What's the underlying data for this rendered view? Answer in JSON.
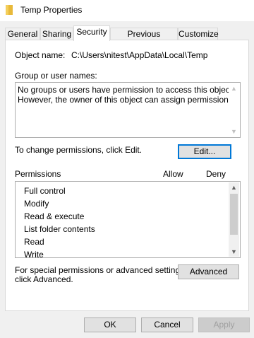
{
  "window": {
    "title": "Temp Properties"
  },
  "tabs": [
    {
      "label": "General"
    },
    {
      "label": "Sharing"
    },
    {
      "label": "Security"
    },
    {
      "label": "Previous Versions"
    },
    {
      "label": "Customize"
    }
  ],
  "object": {
    "label": "Object name:",
    "value": "C:\\Users\\nitest\\AppData\\Local\\Temp"
  },
  "groups": {
    "label": "Group or user names:",
    "message_line1": "No groups or users have permission to access this object.",
    "message_line2": "However, the owner of this object can assign permissions."
  },
  "change": {
    "text": "To change permissions, click Edit.",
    "edit_label": "Edit..."
  },
  "permissions": {
    "label": "Permissions",
    "allow_label": "Allow",
    "deny_label": "Deny",
    "items": [
      "Full control",
      "Modify",
      "Read & execute",
      "List folder contents",
      "Read",
      "Write"
    ]
  },
  "advanced": {
    "line1": "For special permissions or advanced settings,",
    "line2": "click Advanced.",
    "button_label": "Advanced"
  },
  "footer": {
    "ok_label": "OK",
    "cancel_label": "Cancel",
    "apply_label": "Apply"
  }
}
